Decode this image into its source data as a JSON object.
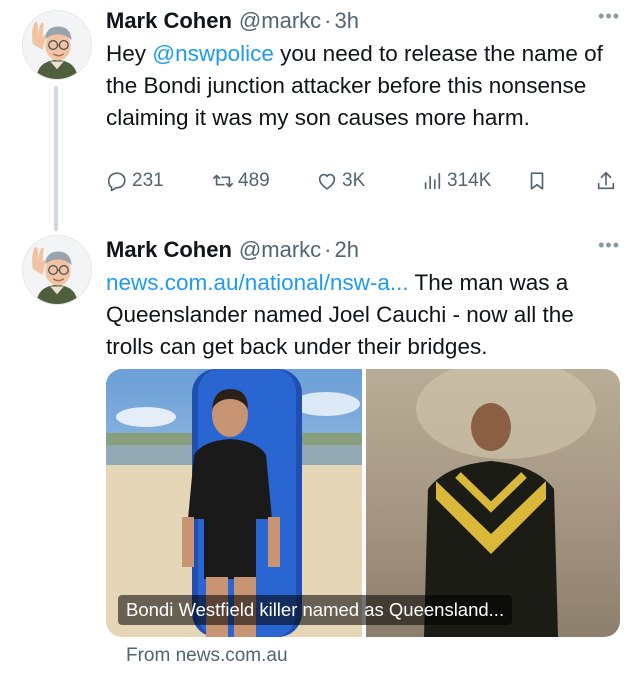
{
  "tweets": [
    {
      "author_name": "Mark Cohen",
      "handle": "@markc",
      "separator": "·",
      "time": "3h",
      "text_before": "Hey ",
      "mention": "@nswpolice",
      "text_after": " you need to release the name of the Bondi junction attacker before this nonsense claiming it was my son causes more harm.",
      "stats": {
        "replies": "231",
        "reposts": "489",
        "likes": "3K",
        "views": "314K"
      }
    },
    {
      "author_name": "Mark Cohen",
      "handle": "@markc",
      "separator": "·",
      "time": "2h",
      "link": "news.com.au/national/nsw-a...",
      "text_after": " The man was a Queenslander named Joel Cauchi - now all the trolls can get back under their bridges.",
      "card": {
        "caption": "Bondi Westfield killer named as Queensland...",
        "source": "From news.com.au"
      }
    }
  ],
  "colors": {
    "accent": "#1d9bf0",
    "text": "#0f1419",
    "secondary": "#536471",
    "thread": "#cfd9de"
  },
  "icons": [
    "avatar-memoji",
    "more-icon",
    "reply-icon",
    "repost-icon",
    "like-icon",
    "views-icon",
    "bookmark-icon",
    "share-icon"
  ]
}
